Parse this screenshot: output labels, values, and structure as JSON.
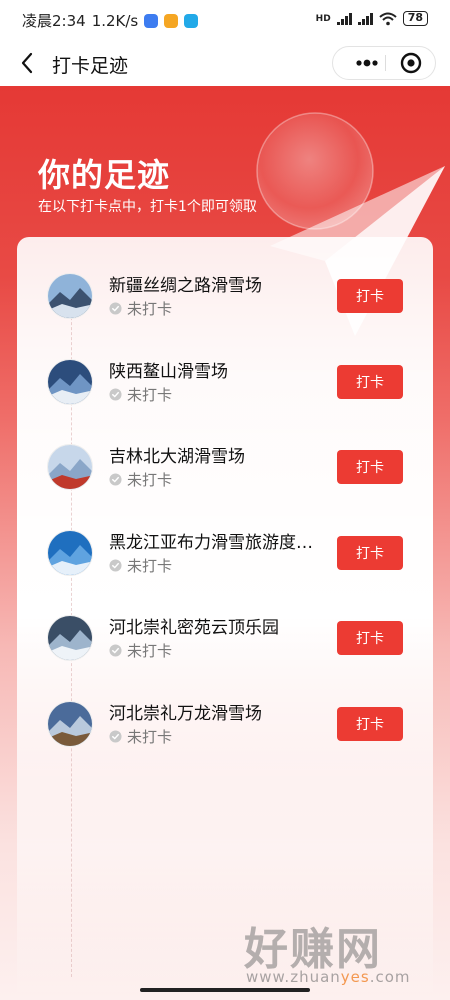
{
  "status_bar": {
    "time": "凌晨2:34",
    "speed": "1.2K/s",
    "network": "HD",
    "battery": "78"
  },
  "nav": {
    "title": "打卡足迹"
  },
  "hero": {
    "title": "你的足迹",
    "subtitle": "在以下打卡点中，打卡1个即可领取"
  },
  "spots": [
    {
      "name": "新疆丝绸之路滑雪场",
      "status": "未打卡",
      "button": "打卡",
      "thumb_colors": [
        "#8fb3d9",
        "#3c5270",
        "#d8e2ee"
      ]
    },
    {
      "name": "陕西鳌山滑雪场",
      "status": "未打卡",
      "button": "打卡",
      "thumb_colors": [
        "#2c4d7c",
        "#6f95c4",
        "#e8eef5"
      ]
    },
    {
      "name": "吉林北大湖滑雪场",
      "status": "未打卡",
      "button": "打卡",
      "thumb_colors": [
        "#c7d7ea",
        "#8aa6c8",
        "#c0392b"
      ]
    },
    {
      "name": "黑龙江亚布力滑雪旅游度假区",
      "status": "未打卡",
      "button": "打卡",
      "thumb_colors": [
        "#1f6fbf",
        "#5fa3e0",
        "#e6f0fa"
      ]
    },
    {
      "name": "河北崇礼密苑云顶乐园",
      "status": "未打卡",
      "button": "打卡",
      "thumb_colors": [
        "#3a4e66",
        "#9db4cc",
        "#eef3f8"
      ]
    },
    {
      "name": "河北崇礼万龙滑雪场",
      "status": "未打卡",
      "button": "打卡",
      "thumb_colors": [
        "#4b6b9a",
        "#b9c9dc",
        "#7a5a3a"
      ]
    }
  ],
  "watermark": {
    "main": "好赚网",
    "url_prefix": "www.zhuan",
    "url_highlight": "yes",
    "url_suffix": ".com"
  },
  "colors": {
    "brand_red": "#ec3b33",
    "hero_top": "#e53935"
  }
}
